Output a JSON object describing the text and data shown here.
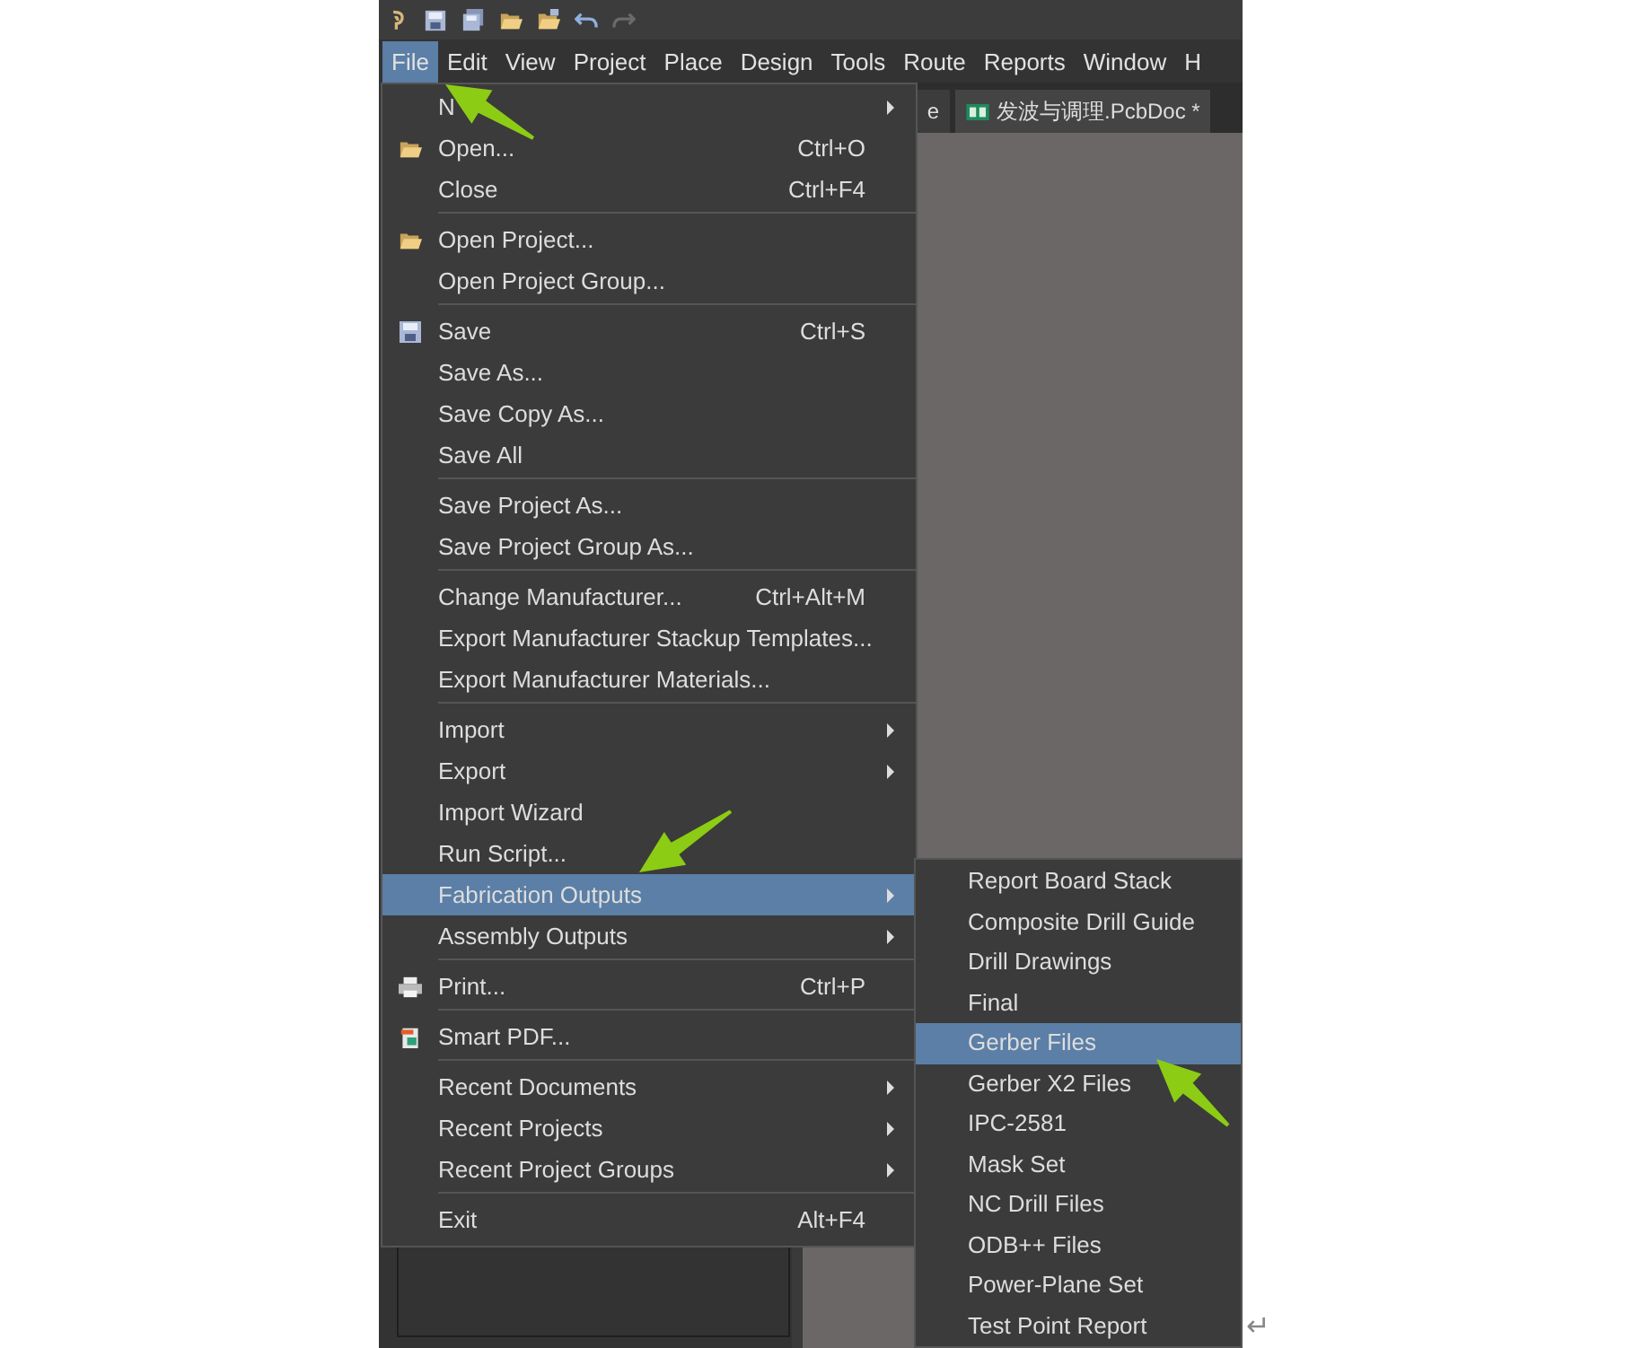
{
  "menubar": [
    {
      "label": "File",
      "selected": true
    },
    {
      "label": "Edit",
      "selected": false
    },
    {
      "label": "View",
      "selected": false
    },
    {
      "label": "Project",
      "selected": false
    },
    {
      "label": "Place",
      "selected": false
    },
    {
      "label": "Design",
      "selected": false
    },
    {
      "label": "Tools",
      "selected": false
    },
    {
      "label": "Route",
      "selected": false
    },
    {
      "label": "Reports",
      "selected": false
    },
    {
      "label": "Window",
      "selected": false
    },
    {
      "label": "H",
      "selected": false
    }
  ],
  "document_tabs": [
    {
      "label": "e",
      "selected": false
    },
    {
      "label": "发波与调理.PcbDoc *",
      "selected": true
    }
  ],
  "file_menu": [
    {
      "kind": "submenu",
      "label": "N",
      "selected": false
    },
    {
      "kind": "folder",
      "label": "Open...",
      "shortcut": "Ctrl+O",
      "selected": false
    },
    {
      "kind": "item",
      "label": "Close",
      "shortcut": "Ctrl+F4",
      "selected": false
    },
    {
      "kind": "separator"
    },
    {
      "kind": "folder",
      "label": "Open Project...",
      "selected": false
    },
    {
      "kind": "item",
      "label": "Open Project Group...",
      "selected": false
    },
    {
      "kind": "separator"
    },
    {
      "kind": "save",
      "label": "Save",
      "shortcut": "Ctrl+S",
      "selected": false
    },
    {
      "kind": "item",
      "label": "Save As...",
      "selected": false
    },
    {
      "kind": "item",
      "label": "Save Copy As...",
      "selected": false
    },
    {
      "kind": "item",
      "label": "Save All",
      "selected": false
    },
    {
      "kind": "separator"
    },
    {
      "kind": "item",
      "label": "Save Project As...",
      "selected": false
    },
    {
      "kind": "item",
      "label": "Save Project Group As...",
      "selected": false
    },
    {
      "kind": "separator"
    },
    {
      "kind": "item",
      "label": "Change Manufacturer...",
      "shortcut": "Ctrl+Alt+M",
      "selected": false
    },
    {
      "kind": "item",
      "label": "Export Manufacturer Stackup Templates...",
      "selected": false
    },
    {
      "kind": "item",
      "label": "Export Manufacturer Materials...",
      "selected": false
    },
    {
      "kind": "separator"
    },
    {
      "kind": "submenu",
      "label": "Import",
      "selected": false
    },
    {
      "kind": "submenu",
      "label": "Export",
      "selected": false
    },
    {
      "kind": "item",
      "label": "Import Wizard",
      "selected": false
    },
    {
      "kind": "item",
      "label": "Run Script...",
      "selected": false
    },
    {
      "kind": "submenu",
      "label": "Fabrication Outputs",
      "selected": true
    },
    {
      "kind": "submenu",
      "label": "Assembly Outputs",
      "selected": false
    },
    {
      "kind": "separator"
    },
    {
      "kind": "printer",
      "label": "Print...",
      "shortcut": "Ctrl+P",
      "selected": false
    },
    {
      "kind": "separator"
    },
    {
      "kind": "pdf",
      "label": "Smart PDF...",
      "selected": false
    },
    {
      "kind": "separator"
    },
    {
      "kind": "submenu",
      "label": "Recent Documents",
      "selected": false
    },
    {
      "kind": "submenu",
      "label": "Recent Projects",
      "selected": false
    },
    {
      "kind": "submenu",
      "label": "Recent Project Groups",
      "selected": false
    },
    {
      "kind": "separator"
    },
    {
      "kind": "item",
      "label": "Exit",
      "shortcut": "Alt+F4",
      "selected": false
    }
  ],
  "fabrication_submenu": [
    {
      "label": "Report Board Stack",
      "selected": false
    },
    {
      "label": "Composite Drill Guide",
      "selected": false
    },
    {
      "label": "Drill Drawings",
      "selected": false
    },
    {
      "label": "Final",
      "selected": false
    },
    {
      "label": "Gerber Files",
      "selected": true
    },
    {
      "label": "Gerber X2 Files",
      "selected": false
    },
    {
      "label": "IPC-2581",
      "selected": false
    },
    {
      "label": "Mask Set",
      "selected": false
    },
    {
      "label": "NC Drill Files",
      "selected": false
    },
    {
      "label": "ODB++ Files",
      "selected": false
    },
    {
      "label": "Power-Plane Set",
      "selected": false
    },
    {
      "label": "Test Point Report",
      "selected": false
    }
  ],
  "return_mark": "↵"
}
